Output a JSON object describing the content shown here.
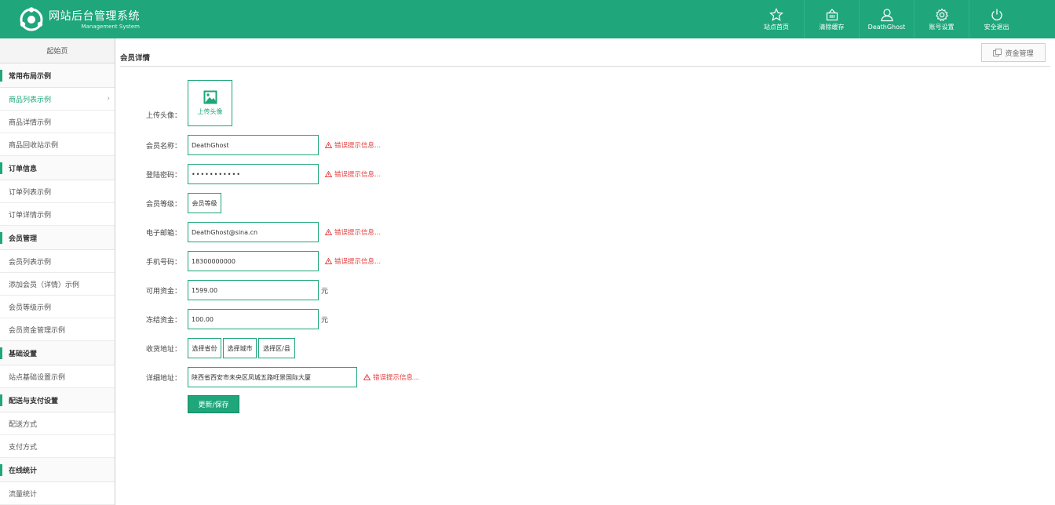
{
  "brand": {
    "title": "网站后台管理系统",
    "subtitle": "Management System"
  },
  "nav": [
    {
      "label": "站点首页",
      "icon": "star-icon"
    },
    {
      "label": "清除缓存",
      "icon": "basket-icon"
    },
    {
      "label": "DeathGhost",
      "icon": "user-icon"
    },
    {
      "label": "账号设置",
      "icon": "gear-icon"
    },
    {
      "label": "安全退出",
      "icon": "power-icon"
    }
  ],
  "sidebar": {
    "home": "起始页",
    "groups": [
      {
        "title": "常用布局示例",
        "items": [
          "商品列表示例",
          "商品详情示例",
          "商品回收站示例"
        ]
      },
      {
        "title": "订单信息",
        "items": [
          "订单列表示例",
          "订单详情示例"
        ]
      },
      {
        "title": "会员管理",
        "items": [
          "会员列表示例",
          "添加会员（详情）示例",
          "会员等级示例",
          "会员资金管理示例"
        ]
      },
      {
        "title": "基础设置",
        "items": [
          "站点基础设置示例"
        ]
      },
      {
        "title": "配送与支付设置",
        "items": [
          "配送方式",
          "支付方式"
        ]
      },
      {
        "title": "在线统计",
        "items": [
          "流量统计"
        ]
      }
    ]
  },
  "page": {
    "title": "会员详情",
    "fund_button": "资金管理"
  },
  "form": {
    "avatar_label": "上传头像：",
    "avatar_button": "上传头像",
    "name_label": "会员名称：",
    "name_value": "DeathGhost",
    "password_label": "登陆密码：",
    "password_value": "•••••••••••",
    "level_label": "会员等级：",
    "level_value": "会员等级",
    "email_label": "电子邮箱：",
    "email_value": "DeathGhost@sina.cn",
    "phone_label": "手机号码：",
    "phone_value": "18300000000",
    "available_label": "可用资金：",
    "available_value": "1599.00",
    "frozen_label": "冻结资金：",
    "frozen_value": "100.00",
    "unit": "元",
    "address_label": "收货地址：",
    "province": "选择省份",
    "city": "选择城市",
    "district": "选择区/县",
    "detail_label": "详细地址：",
    "detail_value": "陕西省西安市未央区凤城五路旺景国际大厦",
    "error_text": "错误提示信息...",
    "save_button": "更新/保存"
  },
  "colors": {
    "accent": "#1fa67a",
    "error": "#e53e3e"
  }
}
